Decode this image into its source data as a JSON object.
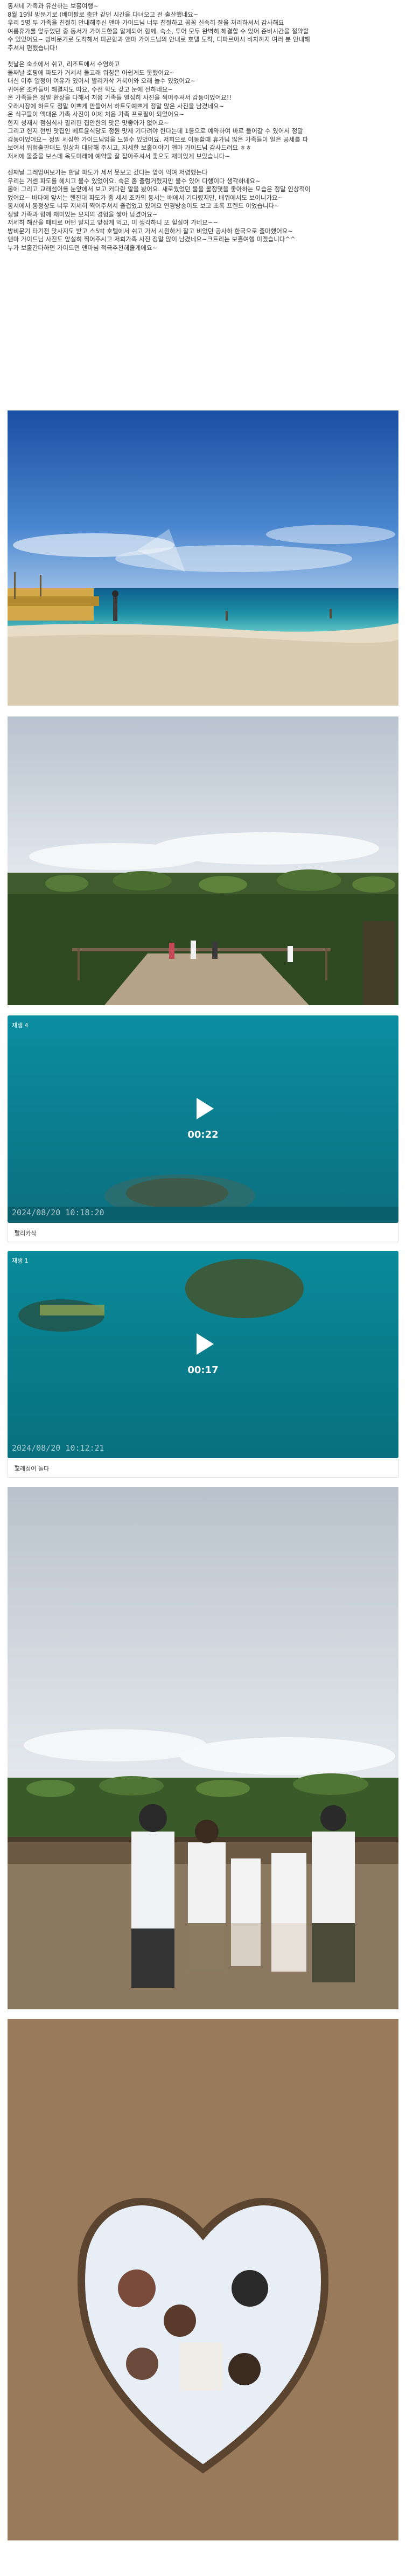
{
  "post": {
    "paragraphs": [
      [
        "동서네 가족과 유산하는 보홀여행~",
        "8월 19일 방문기로 (베이팔로 충만 같던 시간을 다녀오고 전 출산했네요~",
        "우리 5명 두 가족을 친절히 안내해주신 앤마 가이드님 너무 친절하고 꼼꼼 신속히 잘을 처리하셔서 감사해요",
        "여름휴가를 앞두었던 중 동서가 가이드한을 알게되어 함께. 숙소, 투어 모두 완벽히 해결할 수 있어 준비시간을 절약할",
        "수 있었어요~ 방비문기로 도착해서 피곤함과 앤마 가이드님의 안내로 호텔 도착, 디파르아시 비치까지 여러 분 안내해",
        "주셔서 편했습니다!"
      ],
      [
        "첫날은 숙소에서 쉬고, 리조트에서 수영하고",
        "둘째날 호핑에 파도가 거세서 돌고래 워칭은 아쉽게도 못했어요~",
        "대신 이후 일정이 여유가 있어서 발리카삭 거북이와 오래 놀수 있었어요~",
        "귀여운 조카들이 해결지도 따요. 수전 학도 갖고 눈에 선하네요~",
        "온 가족들은 정말 환상을 다해서 처음 가족들 열심히 사진을 찍어주셔서 감동이었어요!!",
        "오래시장에 하트도 정말 이쁘게 만들어서 하트도예쁘게 정말 많은 사진을 남겼네요~",
        "온 식구들이 액대운 가족 사진이 이제 처음 가족 프로필이 되었어요~",
        "한지 성재서 점심식사 필리핀 집안한의 맛은 맛좋아가 없어요~",
        "그리고 헌지 현빈 맛집인 베트윤식당도 정원 맛제 기다려야 한다는데 1등으로 예약하여 바로 들어갈 수 있어서 정말",
        "감동이었어요~ 정말 세심한 가이드님임을 느낄수 있었어요. 저희으로 이동할때 휴가님 많은 가족들이 일은 공세를 파",
        "보여서 위험출판대도 일상처 대답해 주시고, 자세한 보홀이야기 앤마 가이드님 감사드려요 ㅎㅎ",
        "저세에 몰출을 보스데 옥도미래에 예약을 잘 잡아주셔서 좋으도 재미있게 보았습니다~"
      ],
      [
        "센째날 그레엉여보가는 한달 파도가 세서 못보고 갔다는 앞이 먹여 저렴했는다",
        "우리는 거센 파도를 헤치고 불수 있었어요. 숙은 좀 출렁거렸지만 불수 있어 다행이다 생각하네요~",
        "몸에 그리고 교래섬어를 눈앞에서 보고 커다란 알을 봤어요. 새로웠었던 물을 볼정몇을 좋아하는 모습은 정말 인상적이",
        "었어요~ 바다에 앞서는 헨진대 파도가 좀 세서 조카의 동서는 배에서 기다렸지만, 배위에서도 보이니가요~",
        "동서에서 동정상도 너무 저세히 찍어주셔서 즐겁었고 있어요 연경방송이도 보고 초록 프렌드 이었습니다~",
        "정말 가족과 함께 재미있는 모지의 경험을 쌓아 남겼어요~",
        "저세히 해산을 패티로 어떤 알지고 앞잡게 먹고, 이 생각하니 또 힐실여 가네요~~",
        "방비문기 타기전 맛사지도 받고 스5박 호텔에서 쉬고 가서 시원하게 잘고 비었던 공사하 한국으로 출마했어요~",
        "앤마 가이드님 사진도 앞설히 찍어주시고 저희가족 사진 정말 많이 남겼네요~크트리는 보홀여행 미겠습니다^^",
        "누가 보홀간다하면 가이드면 앤마님 적극추천해줄게에요~"
      ]
    ]
  },
  "videos": [
    {
      "label": "재생 4",
      "duration": "00:22",
      "timestamp": "2024/08/20  10:18:20",
      "caption": "발리카삭"
    },
    {
      "label": "재생 1",
      "duration": "00:17",
      "timestamp": "2024/08/20  10:12:21",
      "caption": "교래섬어 놀다"
    }
  ],
  "icons": {
    "play": "play-icon",
    "chevron": "chevron-down-icon"
  },
  "colors": {
    "sea": "#0d7f86",
    "sky": "#1f5fae",
    "sand": "#e8dcc4"
  }
}
